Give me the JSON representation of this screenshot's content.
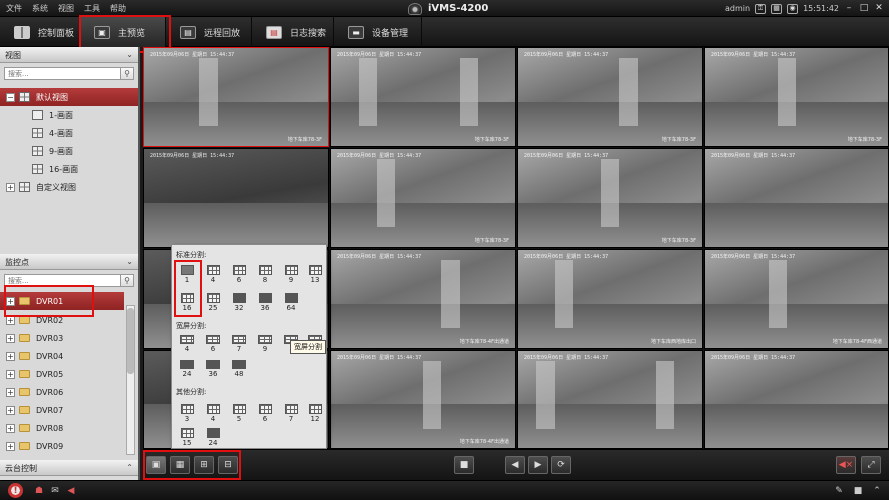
{
  "menubar": {
    "items": [
      "文件",
      "系统",
      "视图",
      "工具",
      "帮助"
    ],
    "app_title": "iVMS-4200",
    "user": "admin",
    "clock": "15:51:42"
  },
  "tabs": [
    {
      "label": "控制面板"
    },
    {
      "label": "主预览"
    },
    {
      "label": "远程回放"
    },
    {
      "label": "日志搜索"
    },
    {
      "label": "设备管理"
    }
  ],
  "left": {
    "view_header": "视图",
    "search_placeholder": "搜索...",
    "default_view": "默认视图",
    "views": [
      "1-画面",
      "4-画面",
      "9-画面",
      "16-画面"
    ],
    "custom_view": "自定义视图",
    "monitor_header": "监控点",
    "devices": [
      "DVR01",
      "DVR02",
      "DVR03",
      "DVR04",
      "DVR05",
      "DVR06",
      "DVR07",
      "DVR08",
      "DVR09"
    ],
    "ptz_header": "云台控制"
  },
  "tiles": {
    "timestamp": "2015年09月06日 星期日 15:44:37",
    "locations": [
      "地下车库78-3F",
      "地下车库78-3F",
      "地下车库78-3F",
      "地下车库78-3F",
      "",
      "地下车库78-3F",
      "地下车库78-3F",
      "",
      "",
      "地下车库78-4F出通道",
      "地下车库西地库出口",
      "地下车库78-4F西通道",
      "",
      "地下车库78-4F出通道",
      "",
      ""
    ]
  },
  "layout_popup": {
    "standard_label": "标准分割:",
    "standard": [
      "1",
      "4",
      "6",
      "8",
      "9",
      "13",
      "16",
      "25",
      "32",
      "36",
      "64"
    ],
    "wide_label": "宽屏分割:",
    "wide": [
      "4",
      "6",
      "7",
      "9",
      "",
      "",
      "24",
      "36",
      "48"
    ],
    "other_label": "其他分割:",
    "other": [
      "3",
      "4",
      "5",
      "6",
      "7",
      "12",
      "15",
      "24"
    ],
    "tooltip": "宽屏分割"
  }
}
